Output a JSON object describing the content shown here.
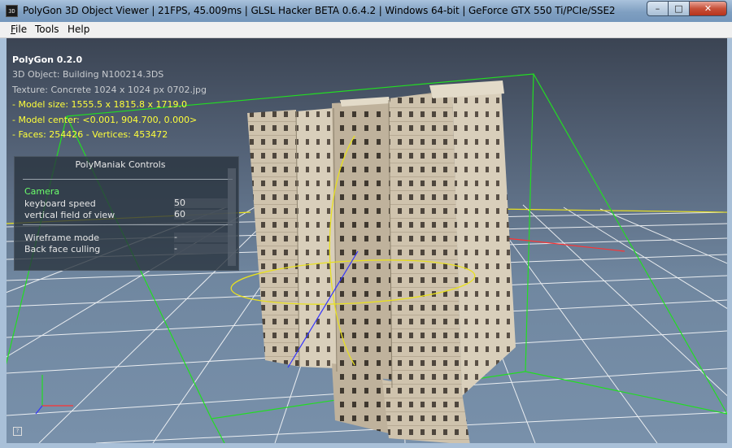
{
  "window": {
    "title": "PolyGon 3D Object Viewer | 21FPS, 45.009ms | GLSL Hacker BETA 0.6.4.2 | Windows 64-bit | GeForce GTX 550 Ti/PCIe/SSE2",
    "icon": "app-icon",
    "controls": {
      "minimize": "–",
      "maximize": "□",
      "close": "✕"
    }
  },
  "menubar": {
    "items": [
      {
        "label": "File",
        "accel": "F",
        "rest": "ile"
      },
      {
        "label": "Tools"
      },
      {
        "label": "Help"
      }
    ]
  },
  "overlay": {
    "app_name": "PolyGon 0.2.0",
    "object_line": "3D Object: Building N100214.3DS",
    "texture_line": "Texture: Concrete 1024 x 1024 px 0702.jpg",
    "model_size_line": "- Model size:  1555.5 x 1815.8 x 1719.0",
    "model_center_line": "- Model center:  <0.001, 904.700, 0.000>",
    "faces_line": "- Faces: 254426 - Vertices: 453472"
  },
  "controls_panel": {
    "title": "PolyManiak Controls",
    "section": "Camera",
    "keyboard_speed_label": "keyboard speed",
    "keyboard_speed_value": "50",
    "fov_label": "vertical field of view",
    "fov_value": "60",
    "wireframe_label": "Wireframe mode",
    "wireframe_value": "-",
    "backface_label": "Back face culling",
    "backface_value": "-"
  },
  "help_icon_glyph": "?",
  "colors": {
    "grid": "#ffffff",
    "bbox": "#22dd22",
    "gizmo_ring": "#e8e020",
    "axis_y": "#ff3333",
    "axis_z": "#3333ff",
    "building": "#cfc3ad",
    "info_yellow": "#ffff3a",
    "camera_green": "#6cff6c"
  }
}
